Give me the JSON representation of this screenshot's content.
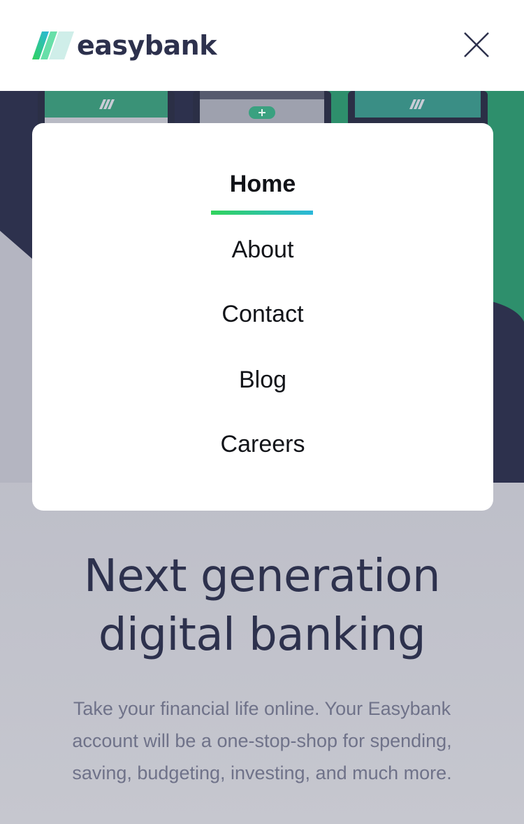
{
  "header": {
    "brand_name": "easybank",
    "logo_icon": "easybank-stripes-logo",
    "close_icon": "close-icon"
  },
  "menu": {
    "items": [
      {
        "label": "Home",
        "active": true
      },
      {
        "label": "About",
        "active": false
      },
      {
        "label": "Contact",
        "active": false
      },
      {
        "label": "Blog",
        "active": false
      },
      {
        "label": "Careers",
        "active": false
      }
    ]
  },
  "hero": {
    "title_line1": "Next generation",
    "title_line2": "digital banking",
    "description_line1": "Take your financial life online. Your Easybank",
    "description_line2": "account will be a one-stop-shop for spending,",
    "description_line3": "saving, budgeting, investing, and much more."
  },
  "colors": {
    "dark_blue": "#2d314d",
    "lime_green": "#31d35c",
    "bright_cyan": "#2bb7da",
    "grayish_blue": "#6f7289",
    "hero_background": "#b4b5c1"
  }
}
